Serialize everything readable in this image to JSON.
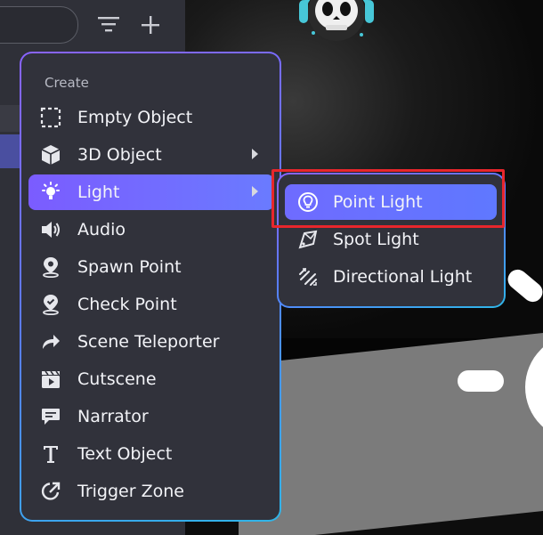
{
  "menu": {
    "header": "Create",
    "items": [
      {
        "label": "Empty Object",
        "icon": "empty-object-icon",
        "has_submenu": false
      },
      {
        "label": "3D Object",
        "icon": "cube-icon",
        "has_submenu": true
      },
      {
        "label": "Light",
        "icon": "light-bulb-icon",
        "has_submenu": true,
        "active": true
      },
      {
        "label": "Audio",
        "icon": "speaker-icon",
        "has_submenu": false
      },
      {
        "label": "Spawn Point",
        "icon": "spawn-point-icon",
        "has_submenu": false
      },
      {
        "label": "Check Point",
        "icon": "check-point-icon",
        "has_submenu": false
      },
      {
        "label": "Scene Teleporter",
        "icon": "teleport-arrow-icon",
        "has_submenu": false
      },
      {
        "label": "Cutscene",
        "icon": "clapperboard-icon",
        "has_submenu": false
      },
      {
        "label": "Narrator",
        "icon": "speech-bubble-icon",
        "has_submenu": false
      },
      {
        "label": "Text Object",
        "icon": "text-icon",
        "has_submenu": false
      },
      {
        "label": "Trigger Zone",
        "icon": "trigger-zone-icon",
        "has_submenu": false
      }
    ]
  },
  "submenu": {
    "items": [
      {
        "label": "Point Light",
        "icon": "point-light-icon",
        "active": true
      },
      {
        "label": "Spot Light",
        "icon": "spot-light-icon"
      },
      {
        "label": "Directional Light",
        "icon": "directional-light-icon"
      }
    ]
  },
  "colors": {
    "accent": "#7b5cff",
    "menu_bg": "#31323b",
    "highlight": "#e8262c"
  }
}
